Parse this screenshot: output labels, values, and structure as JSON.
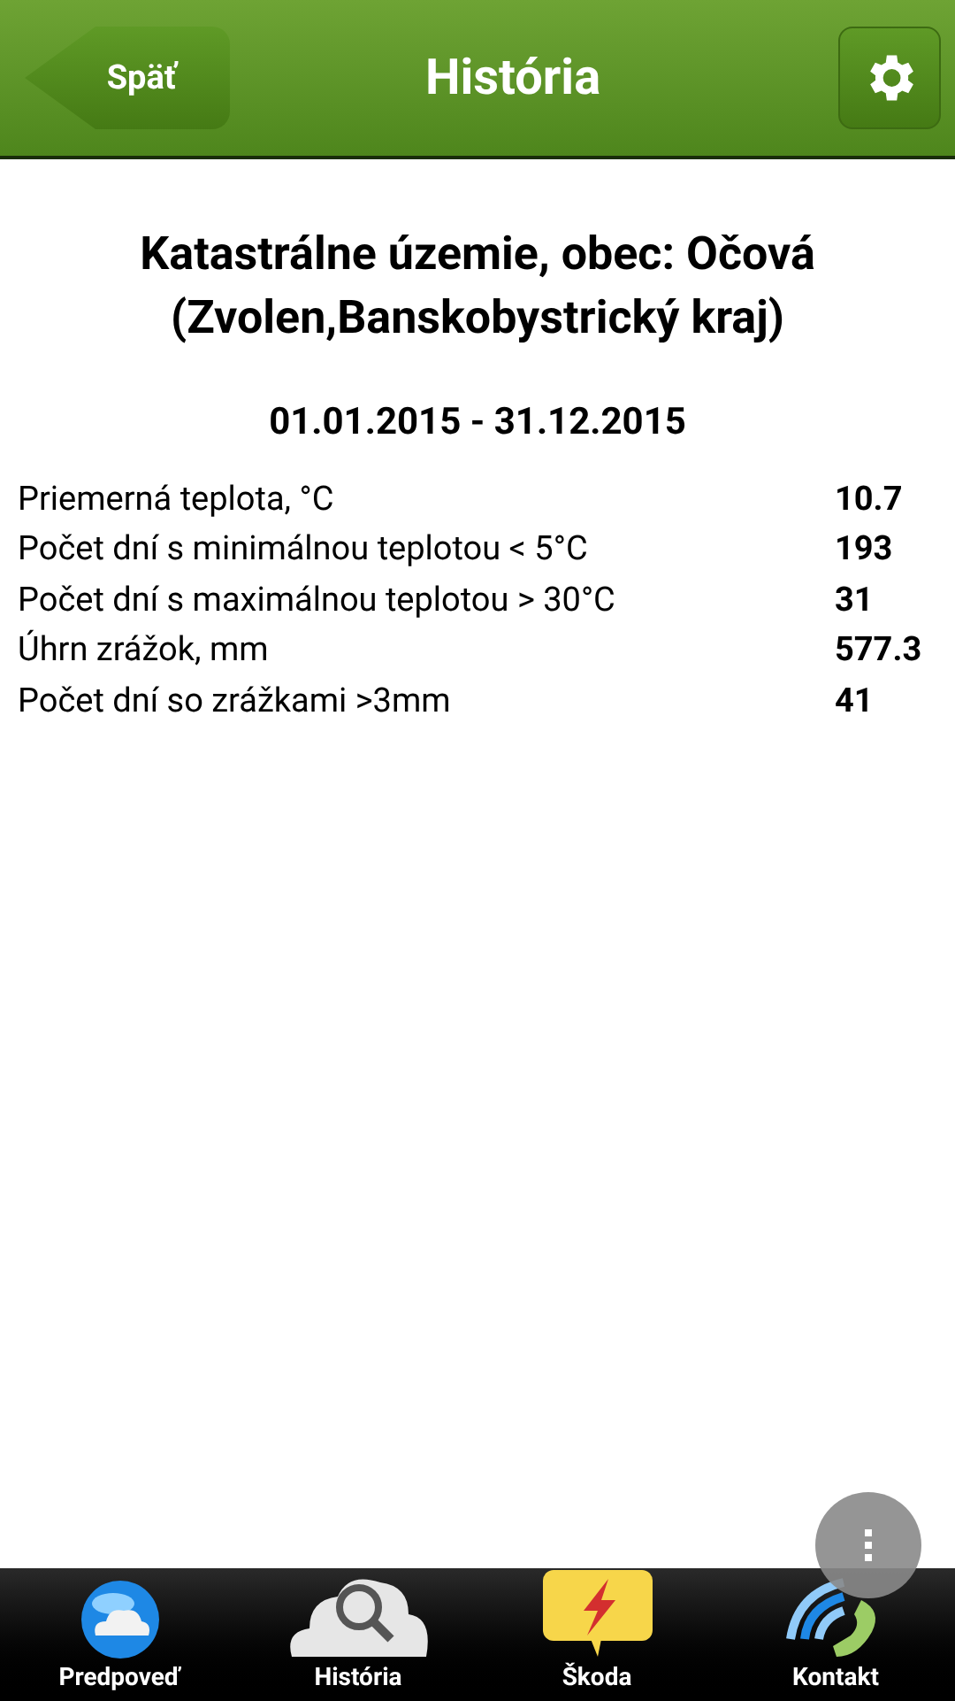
{
  "header": {
    "back_button": "Späť",
    "title": "História"
  },
  "location": {
    "line_1": "Katastrálne územie, obec: Očová",
    "line_2": "(Zvolen,Banskobystrický kraj)"
  },
  "period": "01.01.2015 - 31.12.2015",
  "stats": [
    {
      "label": "Priemerná teplota, °C",
      "value": "10.7"
    },
    {
      "label": "Počet dní s minimálnou teplotou < 5°C",
      "value": "193"
    },
    {
      "label": "Počet dní s maximálnou teplotou > 30°C",
      "value": "31"
    },
    {
      "label": "Úhrn zrážok, mm",
      "value": "577.3"
    },
    {
      "label": "Počet dní so zrážkami >3mm",
      "value": "41"
    }
  ],
  "tabs": [
    {
      "label": "Predpoveď",
      "kind": "forecast"
    },
    {
      "label": "História",
      "kind": "history"
    },
    {
      "label": "Škoda",
      "kind": "damage"
    },
    {
      "label": "Kontakt",
      "kind": "contact"
    }
  ]
}
